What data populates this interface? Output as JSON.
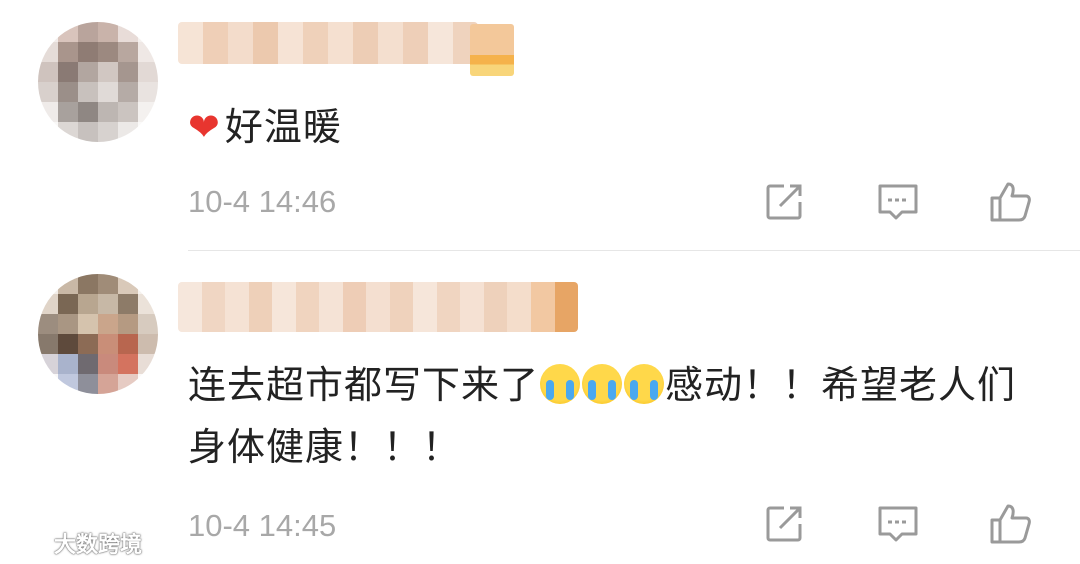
{
  "comments": [
    {
      "text": "好温暖",
      "has_heart_prefix": true,
      "timestamp": "10-4 14:46",
      "actions": {
        "share_icon": "share-icon",
        "reply_icon": "reply-icon",
        "like_icon": "thumbs-up-icon"
      }
    },
    {
      "text_part1": "连去超市都写下来了",
      "emoji_count": 3,
      "text_part2": "感动！！希望老人们身体健康！！！",
      "timestamp": "10-4 14:45",
      "actions": {
        "share_icon": "share-icon",
        "reply_icon": "reply-icon",
        "like_icon": "thumbs-up-icon"
      }
    }
  ],
  "watermark": {
    "text": "大数跨境"
  },
  "colors": {
    "text": "#222222",
    "meta": "#a8a8a8",
    "heart": "#e8352f",
    "divider": "#e6e6e6"
  }
}
